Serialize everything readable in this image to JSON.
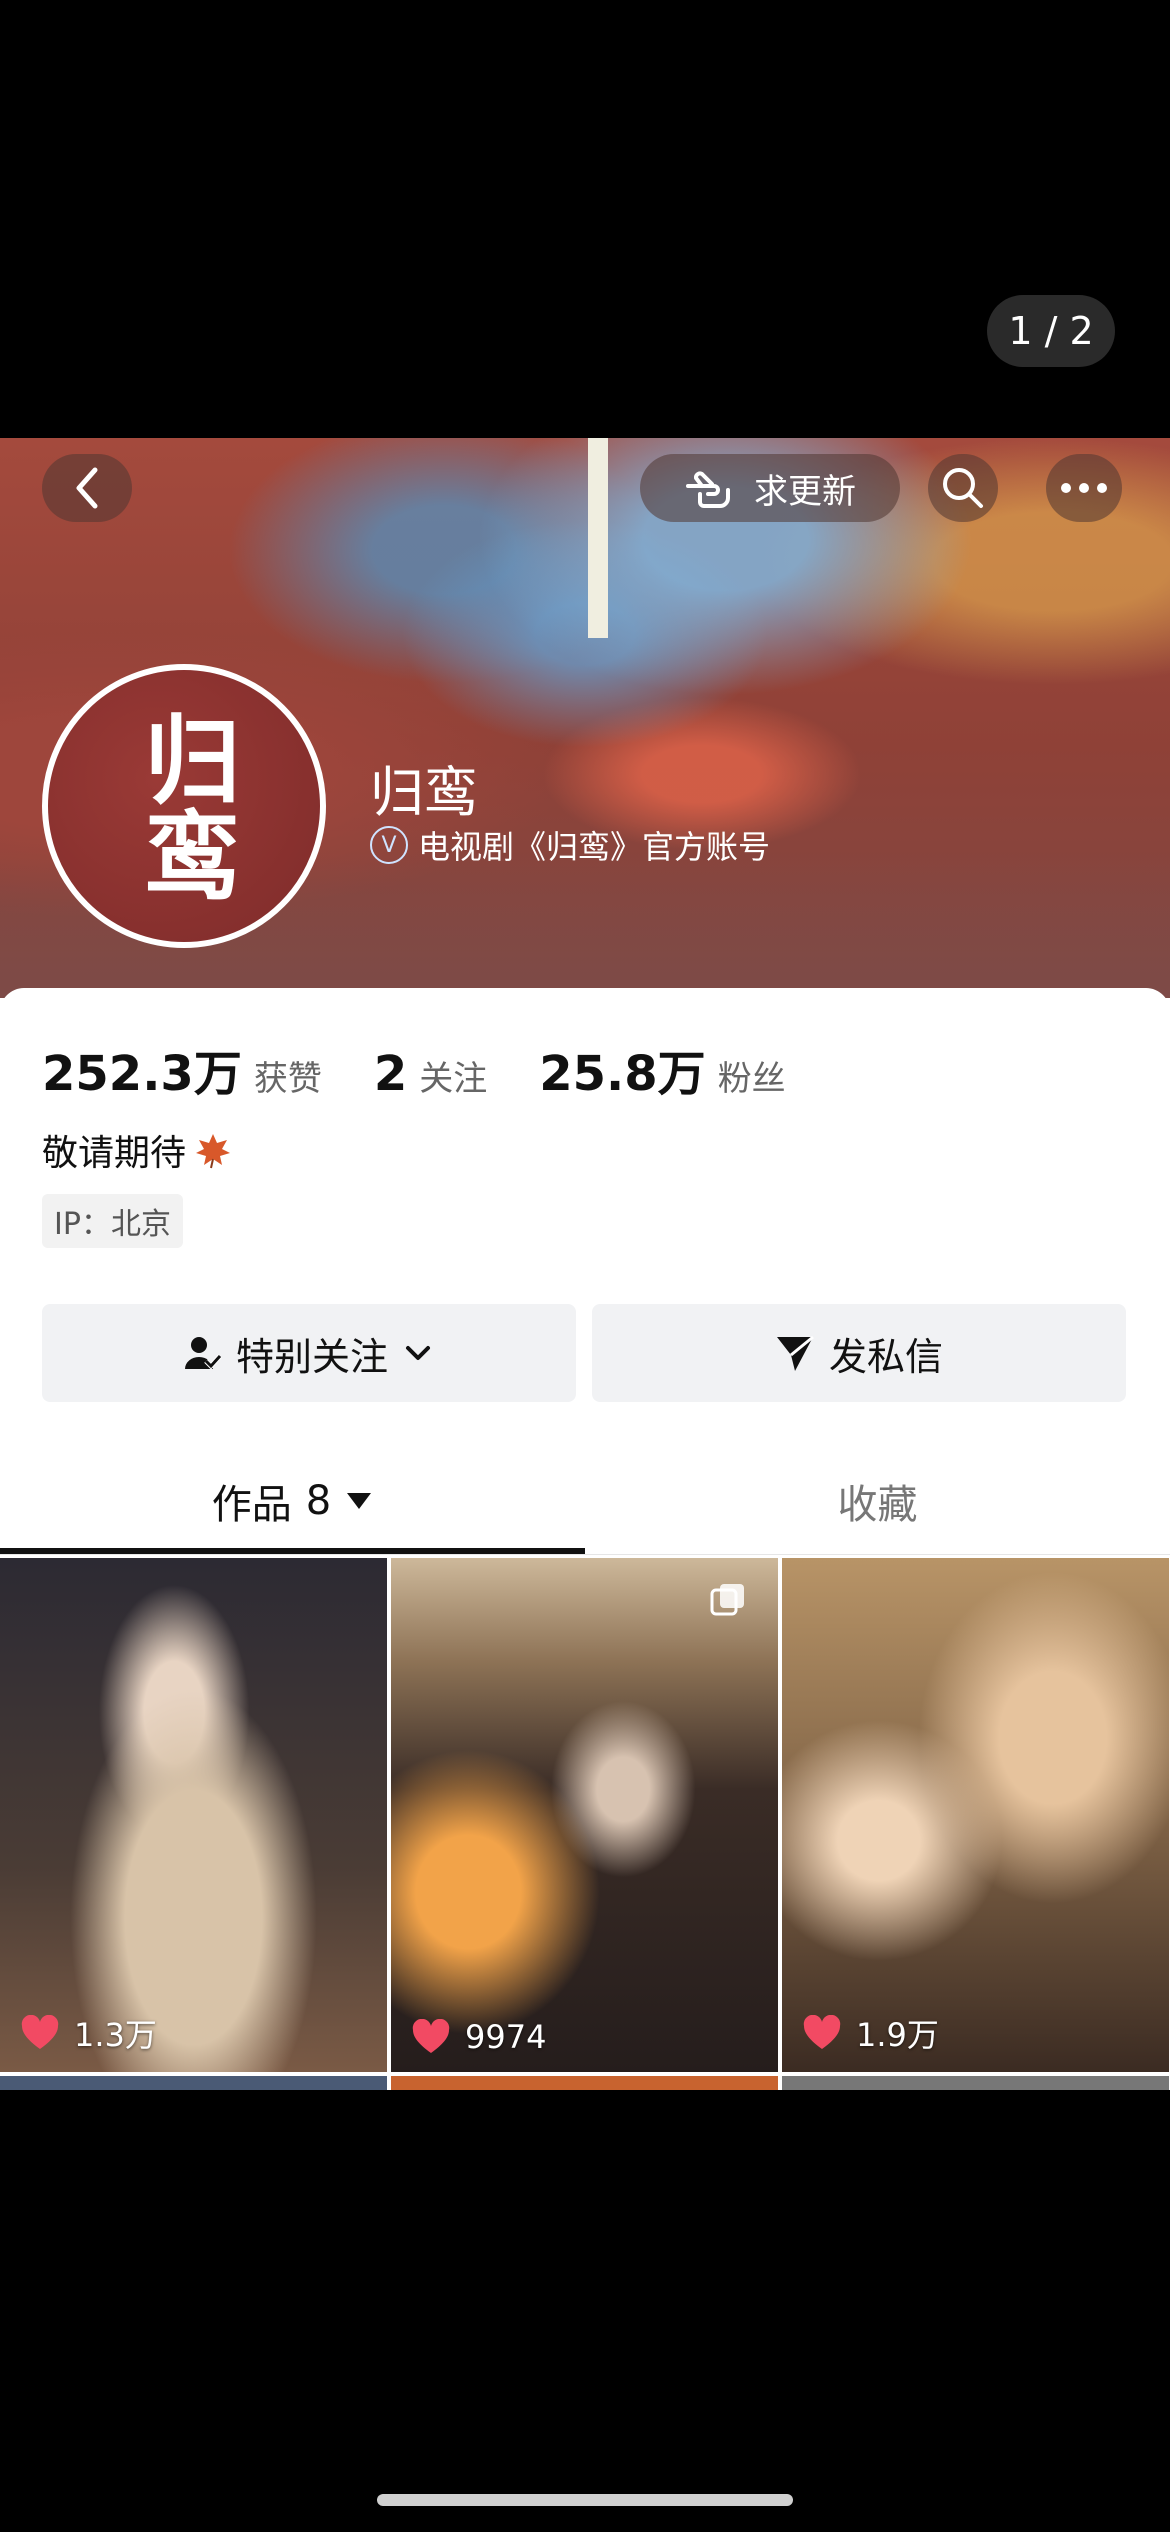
{
  "viewer": {
    "page_counter": "1 / 2"
  },
  "topbar": {
    "update_label": "求更新"
  },
  "profile": {
    "name": "归鸾",
    "avatar_text": "归鸾",
    "verified_label": "电视剧《归鸾》官方账号",
    "verified_icon": "V"
  },
  "stats": [
    {
      "value": "252.3万",
      "label": "获赞"
    },
    {
      "value": "2",
      "label": "关注"
    },
    {
      "value": "25.8万",
      "label": "粉丝"
    }
  ],
  "bio": "敬请期待",
  "ip_location": "IP：北京",
  "actions": {
    "follow_label": "特别关注",
    "message_label": "发私信"
  },
  "tabs": {
    "works_label": "作品",
    "works_count": "8",
    "saved_label": "收藏"
  },
  "videos": [
    {
      "likes": "1.3万"
    },
    {
      "likes": "9974"
    },
    {
      "likes": "1.9万"
    }
  ],
  "colors": {
    "like_heart": "#f24a63",
    "accent_black": "#111111"
  }
}
